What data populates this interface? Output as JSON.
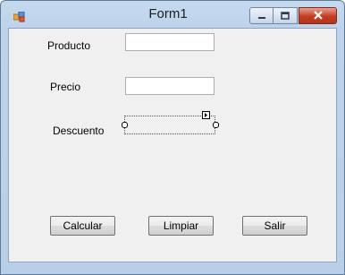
{
  "window": {
    "title": "Form1",
    "icon": "form-app-icon",
    "controls": [
      "minimize-icon",
      "maximize-icon",
      "close-icon"
    ]
  },
  "form": {
    "producto_label": "Producto",
    "producto_value": "",
    "precio_label": "Precio",
    "precio_value": "",
    "descuento_label": "Descuento",
    "descuento_value": ""
  },
  "buttons": {
    "calcular": "Calcular",
    "limpiar": "Limpiar",
    "salir": "Salir"
  },
  "colors": {
    "close_button": "#c43c22",
    "client_background": "#f0f0f0",
    "frame": "#bed3eb"
  }
}
